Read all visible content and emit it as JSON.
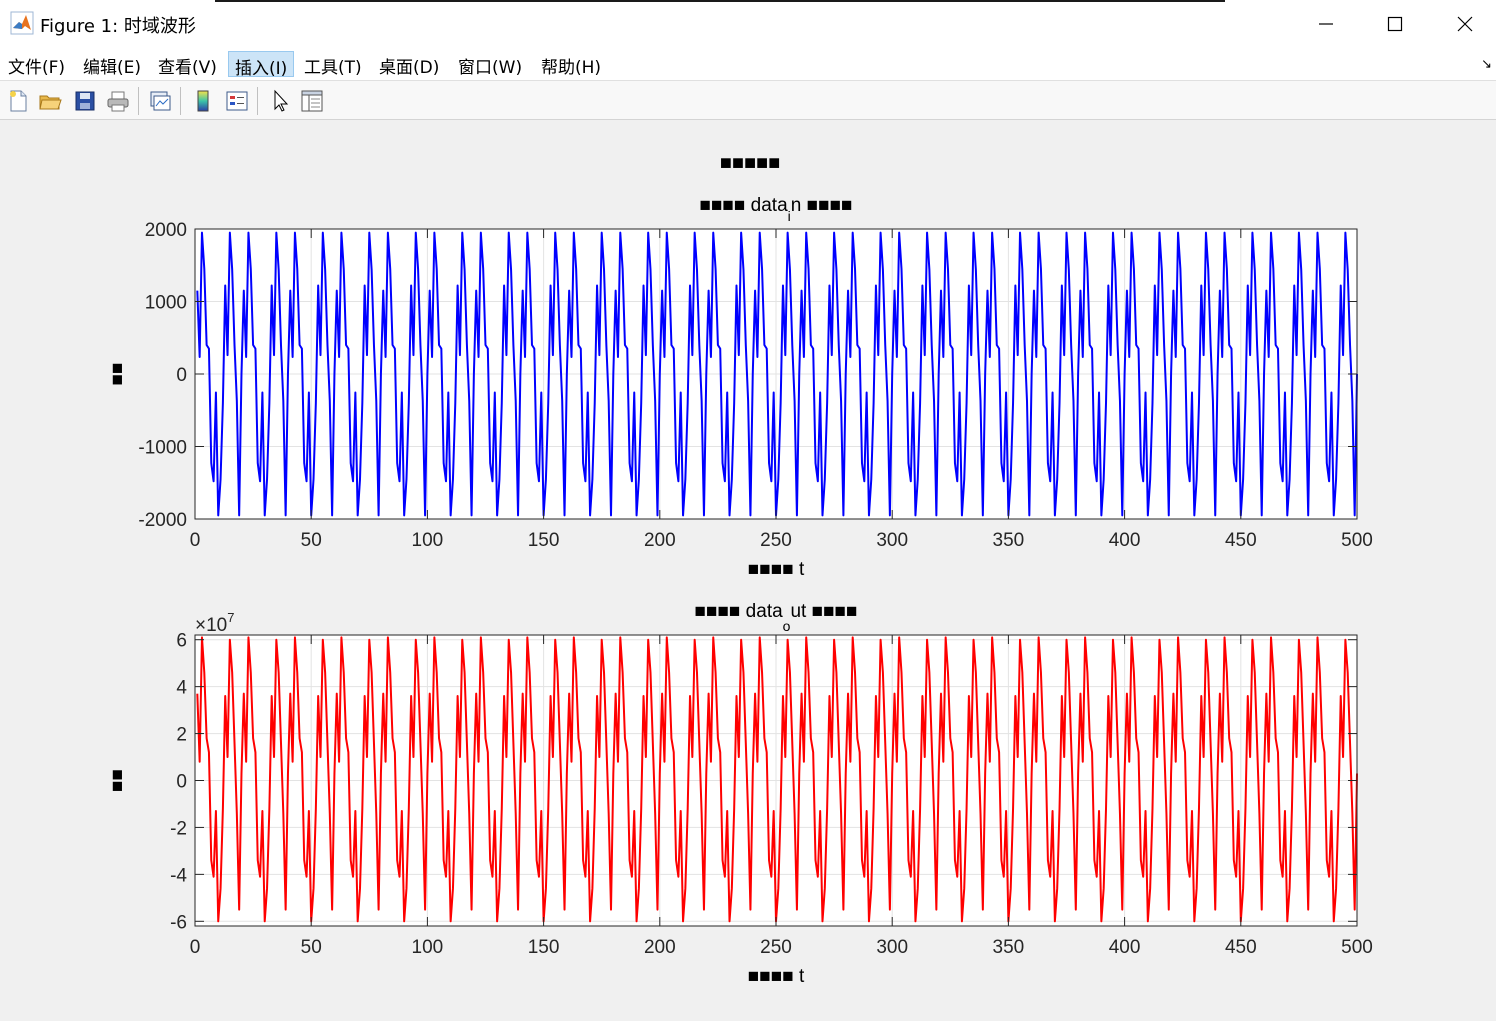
{
  "window": {
    "title": "Figure 1: 时域波形",
    "min_glyph": "—",
    "max_glyph": "☐",
    "close_glyph": "✕"
  },
  "menu": {
    "items": [
      {
        "label": "文件(F)"
      },
      {
        "label": "编辑(E)"
      },
      {
        "label": "查看(V)"
      },
      {
        "label": "插入(I)"
      },
      {
        "label": "工具(T)"
      },
      {
        "label": "桌面(D)"
      },
      {
        "label": "窗口(W)"
      },
      {
        "label": "帮助(H)"
      }
    ],
    "active_index": 3,
    "dock_arrow": "↘"
  },
  "toolbar": {
    "icons": [
      "new-figure-icon",
      "open-folder-icon",
      "save-icon",
      "print-icon",
      "link-plot-icon",
      "colorbar-icon",
      "legend-icon",
      "edit-plot-cursor-icon",
      "property-inspector-icon"
    ]
  },
  "chart_data": [
    {
      "type": "line",
      "suptitle": "■■■■■",
      "title": "■■■■ data_in ■■■■",
      "title_parts": {
        "pre": "■■■■ data",
        "sub": "i",
        "post": "n ■■■■"
      },
      "xlabel": "■■■■ t",
      "ylabel": "■■",
      "xlim": [
        0,
        500
      ],
      "ylim": [
        -2000,
        2000
      ],
      "xticks": [
        0,
        50,
        100,
        150,
        200,
        250,
        300,
        350,
        400,
        450,
        500
      ],
      "yticks": [
        -2000,
        -1000,
        0,
        1000,
        2000
      ],
      "ytick_labels": [
        "-2000",
        "-1000",
        "0",
        "1000",
        "2000"
      ],
      "grid": true,
      "color": "#0000ff",
      "x_range": [
        1,
        500
      ],
      "sample_step": 1,
      "period": 20,
      "one_period_values": [
        0,
        1150,
        235,
        1950,
        1450,
        400,
        350,
        -1230,
        -1480,
        -255,
        -1950,
        -1450,
        -400,
        1220,
        260,
        1950,
        1440,
        400,
        -370,
        -1950
      ]
    },
    {
      "type": "line",
      "title": "■■■■ data_out ■■■■",
      "title_parts": {
        "pre": "■■■■ data",
        "sub": "o",
        "post": "ut ■■■■"
      },
      "xlabel": "■■■■ t",
      "ylabel": "■■",
      "xlim": [
        0,
        500
      ],
      "ylim": [
        -6.2,
        6.2
      ],
      "exponent_label": "×10",
      "exponent_power": "7",
      "xticks": [
        0,
        50,
        100,
        150,
        200,
        250,
        300,
        350,
        400,
        450,
        500
      ],
      "yticks": [
        -6,
        -4,
        -2,
        0,
        2,
        4,
        6
      ],
      "ytick_labels": [
        "-6",
        "-4",
        "-2",
        "0",
        "2",
        "4",
        "6"
      ],
      "grid": true,
      "color": "#ff0000",
      "x_range": [
        1,
        500
      ],
      "sample_step": 1,
      "period": 20,
      "one_period_values": [
        0.3,
        3.7,
        0.8,
        6.1,
        4.6,
        1.8,
        1.2,
        -3.4,
        -4.1,
        -1.3,
        -6.0,
        -4.6,
        -1.2,
        3.6,
        1.0,
        6.0,
        4.6,
        1.6,
        -1.4,
        -5.5
      ]
    }
  ]
}
